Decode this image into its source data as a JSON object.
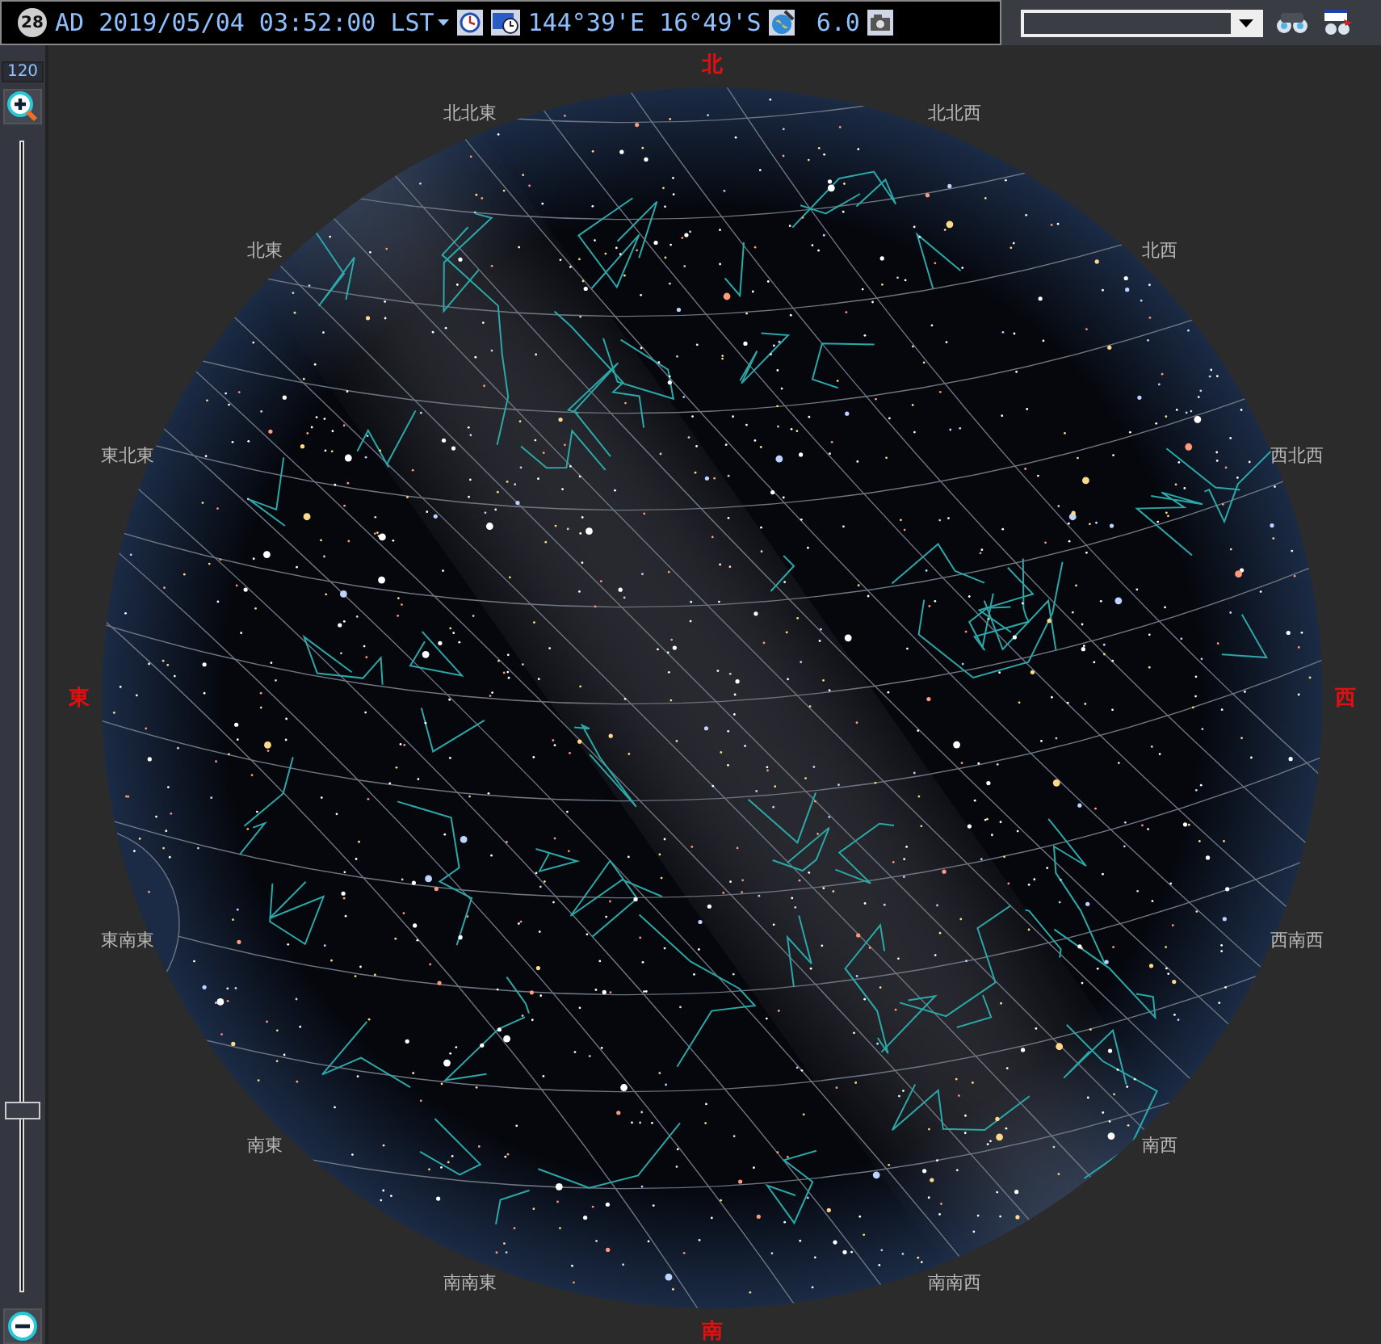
{
  "toolbar": {
    "moon_age": "28",
    "datetime": "AD 2019/05/04 03:52:00 LST",
    "location": "144°39'E 16°49'S",
    "magnitude_limit": "6.0"
  },
  "zoom": {
    "field_of_view": "120",
    "level": 0.15
  },
  "sky_chart": {
    "directions": [
      {
        "label": "北",
        "kind": "cardinal"
      },
      {
        "label": "北北東",
        "kind": "minor"
      },
      {
        "label": "北東",
        "kind": "minor"
      },
      {
        "label": "東北東",
        "kind": "minor"
      },
      {
        "label": "東",
        "kind": "cardinal"
      },
      {
        "label": "東南東",
        "kind": "minor"
      },
      {
        "label": "南東",
        "kind": "minor"
      },
      {
        "label": "南南東",
        "kind": "minor"
      },
      {
        "label": "南",
        "kind": "cardinal"
      },
      {
        "label": "南南西",
        "kind": "minor"
      },
      {
        "label": "南西",
        "kind": "minor"
      },
      {
        "label": "西南西",
        "kind": "minor"
      },
      {
        "label": "西",
        "kind": "cardinal"
      },
      {
        "label": "西北西",
        "kind": "minor"
      },
      {
        "label": "北西",
        "kind": "minor"
      },
      {
        "label": "北北西",
        "kind": "minor"
      }
    ]
  }
}
